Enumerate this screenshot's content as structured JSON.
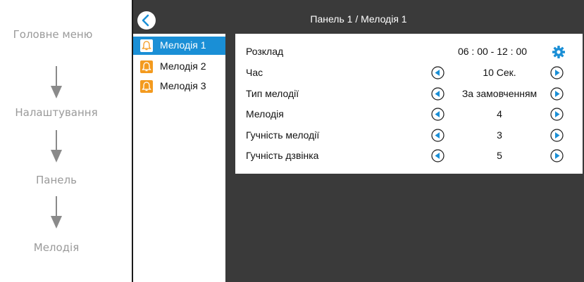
{
  "flow": {
    "steps": [
      "Головне меню",
      "Налаштування",
      "Панель",
      "Мелодія"
    ]
  },
  "header": {
    "title": "Панель 1 / Мелодія 1"
  },
  "list": {
    "items": [
      {
        "label": "Мелодія 1",
        "selected": true
      },
      {
        "label": "Мелодія 2",
        "selected": false
      },
      {
        "label": "Мелодія 3",
        "selected": false
      }
    ]
  },
  "settings": {
    "schedule_label": "Розклад",
    "schedule_value": "06 : 00 - 12 : 00",
    "rows": [
      {
        "label": "Час",
        "value": "10 Сек."
      },
      {
        "label": "Тип мелодії",
        "value": "За замовченням"
      },
      {
        "label": "Мелодія",
        "value": "4"
      },
      {
        "label": "Гучність мелодії",
        "value": "3"
      },
      {
        "label": "Гучність дзвінка",
        "value": "5"
      }
    ]
  },
  "colors": {
    "accent": "#1a8fd6",
    "bell": "#f39a1e",
    "screen_bg": "#3a3a3a"
  },
  "icons": [
    "chevron-left-icon",
    "bell-icon",
    "gear-icon",
    "arrow-left-icon",
    "arrow-right-icon"
  ]
}
